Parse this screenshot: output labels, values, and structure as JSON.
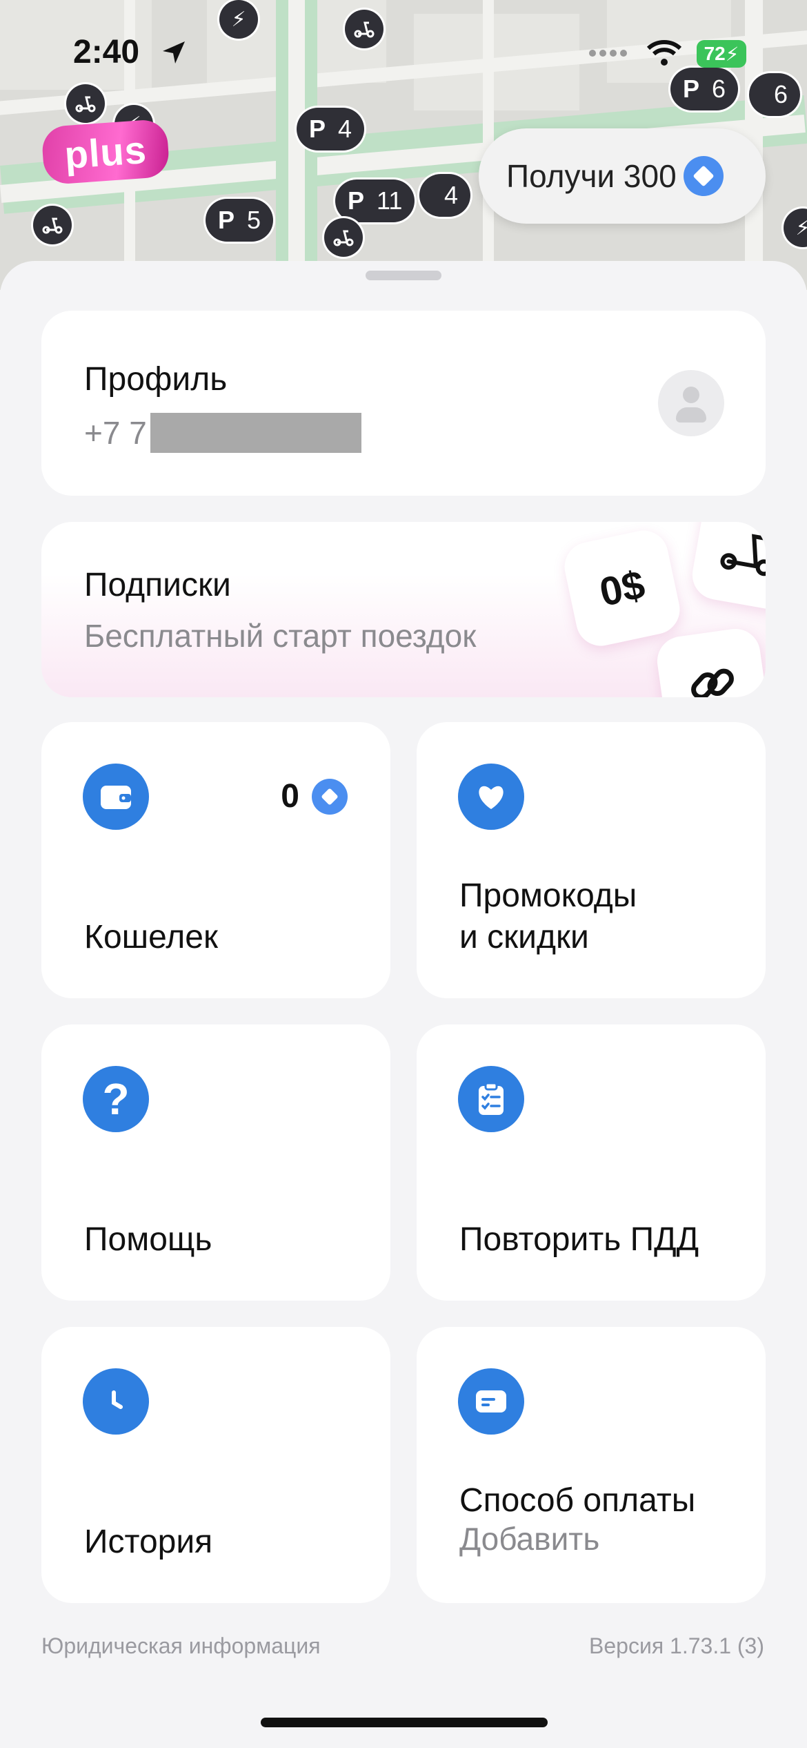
{
  "status_bar": {
    "time": "2:40",
    "battery": "72"
  },
  "map": {
    "plus_label": "plus",
    "parking_pins": [
      {
        "letter": "P",
        "count": "4"
      },
      {
        "letter": "P",
        "count": "5"
      },
      {
        "letter": "P",
        "count": "11"
      },
      {
        "letter": "",
        "count": "4"
      },
      {
        "letter": "P",
        "count": "6"
      },
      {
        "letter": "",
        "count": "6"
      }
    ],
    "promo_button": "Получи 300"
  },
  "profile": {
    "title": "Профиль",
    "phone": "+7 7"
  },
  "subscriptions": {
    "title": "Подписки",
    "subtitle": "Бесплатный старт поездок",
    "tile_price": "0$"
  },
  "wallet": {
    "label": "Кошелек",
    "balance": "0"
  },
  "promo": {
    "label_line1": "Промокоды",
    "label_line2": "и скидки"
  },
  "help": {
    "label": "Помощь"
  },
  "pdd": {
    "label": "Повторить ПДД"
  },
  "history": {
    "label": "История"
  },
  "payment": {
    "label": "Способ оплаты",
    "value": "Добавить"
  },
  "footer": {
    "legal": "Юридическая информация",
    "version": "Версия 1.73.1 (3)"
  },
  "colors": {
    "accent": "#2f7fe0",
    "coin": "#4b8ef0",
    "plus_pink": "#e040a8",
    "battery": "#3bc45a"
  }
}
